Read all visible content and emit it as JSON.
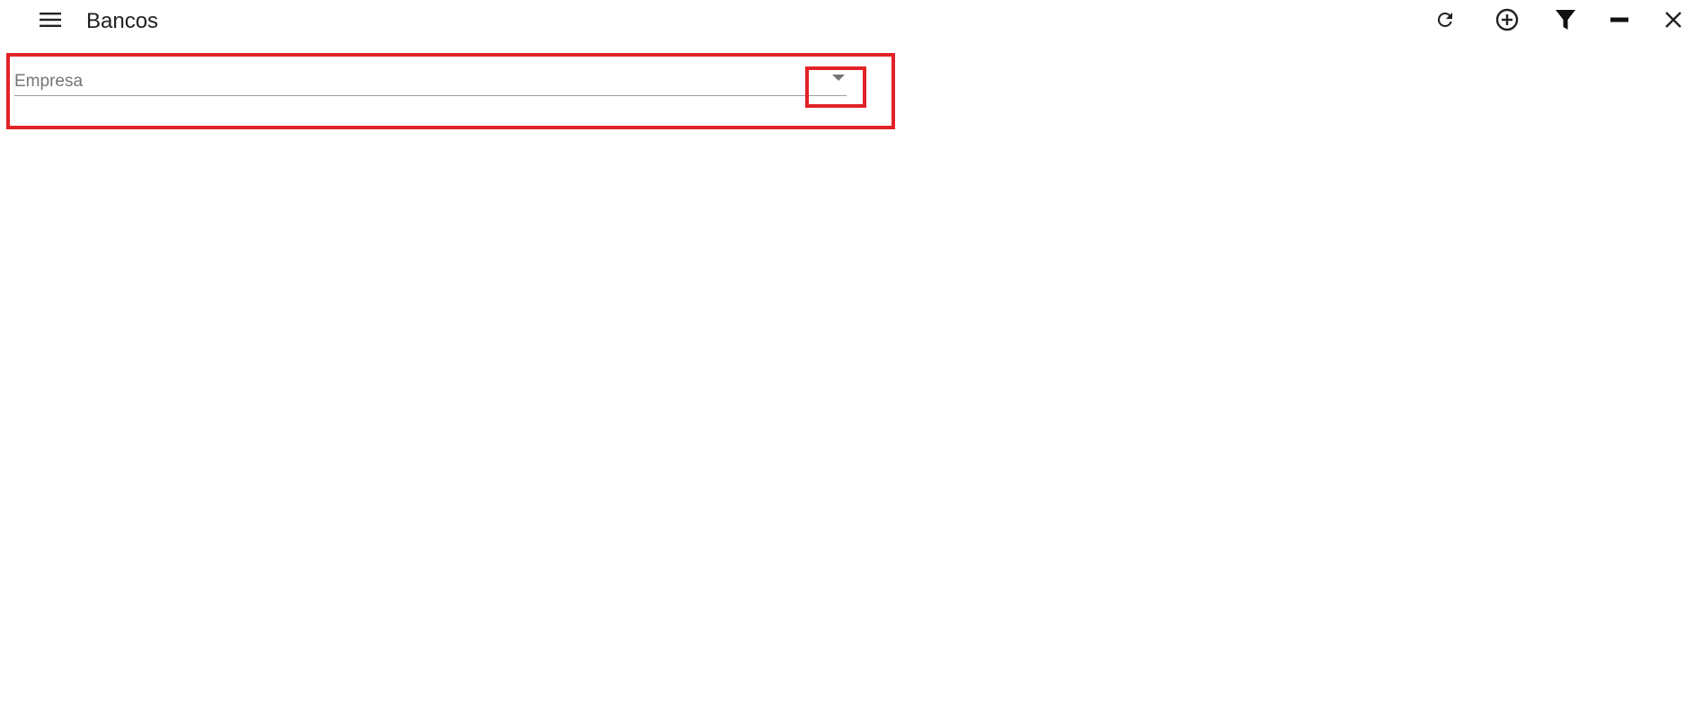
{
  "header": {
    "title": "Bancos",
    "icons": {
      "menu": "menu-icon",
      "refresh": "refresh-icon",
      "add": "add-circle-icon",
      "filter": "filter-icon",
      "minimize": "minimize-icon",
      "close": "close-icon"
    }
  },
  "form": {
    "empresa_label": "Empresa",
    "empresa_value": "",
    "dropdown_icon": "arrow-drop-down-icon"
  },
  "colors": {
    "highlight": "#e32228",
    "label": "#757575",
    "underline": "#9e9e9e",
    "text": "#212121"
  }
}
